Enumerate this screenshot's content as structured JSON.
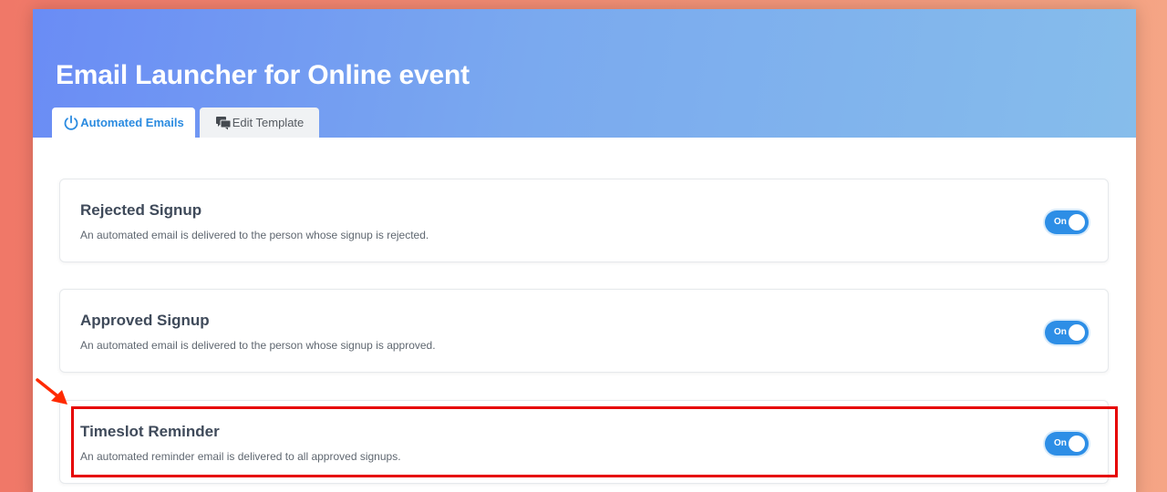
{
  "page": {
    "title": "Email Launcher for Online event"
  },
  "tabs": [
    {
      "label": "Automated Emails",
      "icon": "power-icon",
      "active": true
    },
    {
      "label": "Edit Template",
      "icon": "chat-bubbles-icon",
      "active": false
    }
  ],
  "cards": [
    {
      "title": "Rejected Signup",
      "description": "An automated email is delivered to the person whose signup is rejected.",
      "toggle_label": "On",
      "enabled": true
    },
    {
      "title": "Approved Signup",
      "description": "An automated email is delivered to the person whose signup is approved.",
      "toggle_label": "On",
      "enabled": true
    },
    {
      "title": "Timeslot Reminder",
      "description": "An automated reminder email is delivered to all approved signups.",
      "toggle_label": "On",
      "enabled": true
    }
  ],
  "annotation": {
    "highlight_color": "#e60000",
    "arrow_color": "#ff2a00"
  },
  "colors": {
    "accent": "#2d8ee6",
    "header_start": "#6a8cf5",
    "header_end": "#86bdeb"
  }
}
